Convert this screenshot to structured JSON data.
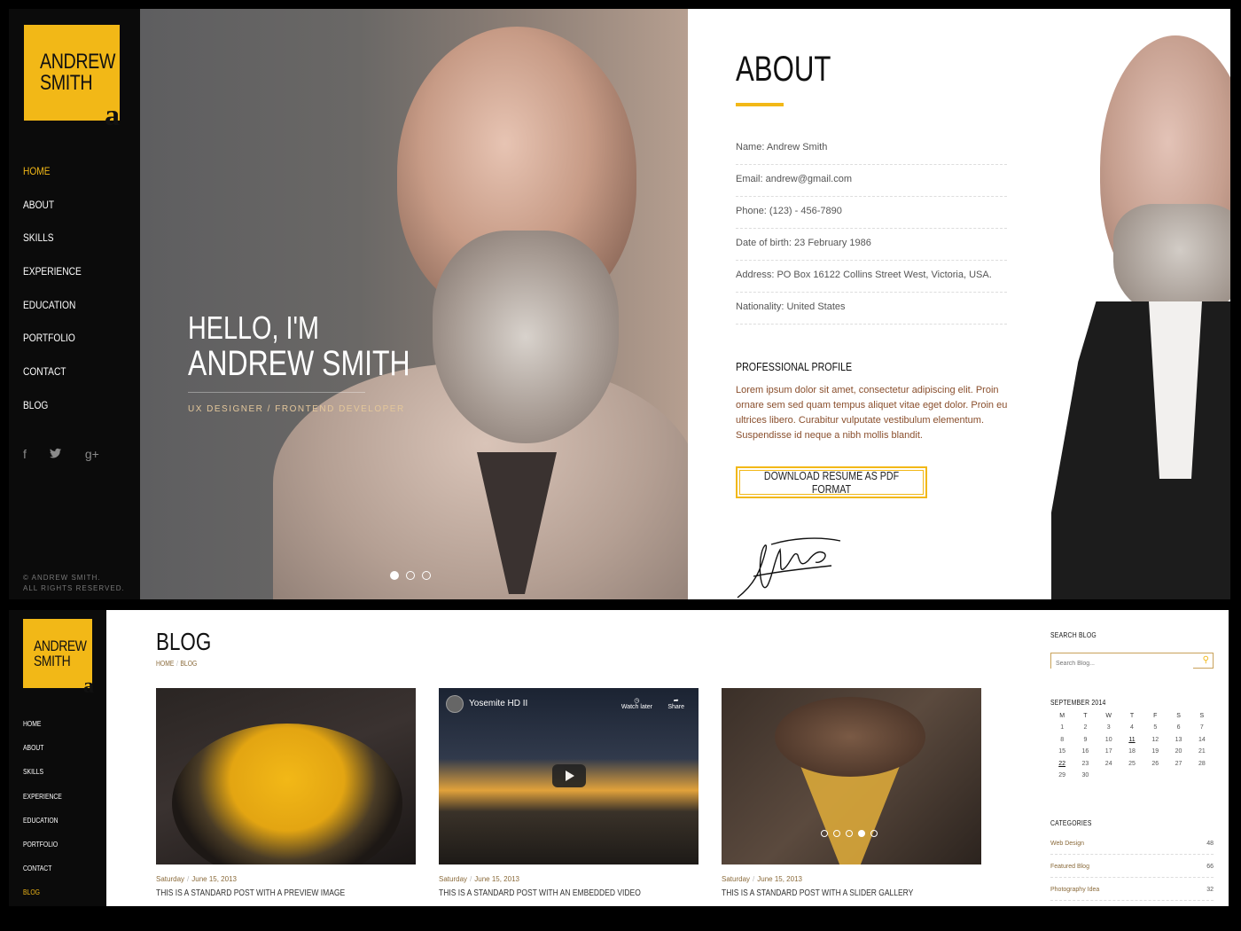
{
  "brand": {
    "line1": "ANDREW",
    "line2": "SMITH",
    "mark": "a"
  },
  "nav": [
    "HOME",
    "ABOUT",
    "SKILLS",
    "EXPERIENCE",
    "EDUCATION",
    "PORTFOLIO",
    "CONTACT",
    "BLOG"
  ],
  "top": {
    "active_nav": "HOME",
    "social_icons": [
      "facebook-icon",
      "twitter-icon",
      "google-plus-icon"
    ],
    "copyright_line1": "© ANDREW SMITH.",
    "copyright_line2": "ALL RIGHTS RESERVED.",
    "hero": {
      "greeting": "HELLO, I'M",
      "name": "ANDREW SMITH",
      "role": "UX DESIGNER / FRONTEND DEVELOPER",
      "slides": 3,
      "active_slide": 1
    },
    "about": {
      "heading": "ABOUT",
      "info": [
        "Name: Andrew Smith",
        "Email: andrew@gmail.com",
        "Phone: (123) - 456-7890",
        "Date of birth: 23 February 1986",
        "Address: PO Box 16122 Collins Street West, Victoria, USA.",
        "Nationality: United States"
      ],
      "profile_heading": "PROFESSIONAL PROFILE",
      "profile_text": "Lorem ipsum dolor sit amet, consectetur adipiscing elit. Proin ornare sem sed quam tempus aliquet vitae eget dolor. Proin eu ultrices libero. Curabitur vulputate vestibulum elementum. Suspendisse id neque a nibh mollis blandit.",
      "resume_button": "DOWNLOAD RESUME AS PDF FORMAT"
    }
  },
  "bottom": {
    "active_nav": "BLOG",
    "heading": "BLOG",
    "breadcrumb": [
      "HOME",
      "BLOG"
    ],
    "posts": [
      {
        "meta_day": "Saturday",
        "meta_date": "June 15, 2013",
        "title": "THIS IS A STANDARD POST WITH A PREVIEW IMAGE"
      },
      {
        "meta_day": "Saturday",
        "meta_date": "June 15, 2013",
        "title": "THIS IS A STANDARD POST WITH AN EMBEDDED VIDEO",
        "video_title": "Yosemite HD II",
        "watch_later": "Watch later",
        "share": "Share"
      },
      {
        "meta_day": "Saturday",
        "meta_date": "June 15, 2013",
        "title": "THIS IS A STANDARD POST WITH A SLIDER GALLERY",
        "slides": 5,
        "active_slide": 4
      }
    ],
    "sidebar": {
      "search_heading": "SEARCH BLOG",
      "search_placeholder": "Search Blog...",
      "calendar_heading": "SEPTEMBER 2014",
      "weekdays": [
        "M",
        "T",
        "W",
        "T",
        "F",
        "S",
        "S"
      ],
      "weeks": [
        [
          "1",
          "2",
          "3",
          "4",
          "5",
          "6",
          "7"
        ],
        [
          "8",
          "9",
          "10",
          "11",
          "12",
          "13",
          "14"
        ],
        [
          "15",
          "16",
          "17",
          "18",
          "19",
          "20",
          "21"
        ],
        [
          "22",
          "23",
          "24",
          "25",
          "26",
          "27",
          "28"
        ],
        [
          "29",
          "30",
          "",
          "",
          "",
          "",
          ""
        ]
      ],
      "linked_days": [
        "11",
        "22"
      ],
      "categories_heading": "CATEGORIES",
      "categories": [
        {
          "name": "Web Design",
          "count": "48"
        },
        {
          "name": "Featured Blog",
          "count": "66"
        },
        {
          "name": "Photography Idea",
          "count": "32"
        }
      ]
    }
  },
  "colors": {
    "accent": "#f2b817",
    "sidebar": "#0b0b0b",
    "link": "#8a6a3a"
  }
}
